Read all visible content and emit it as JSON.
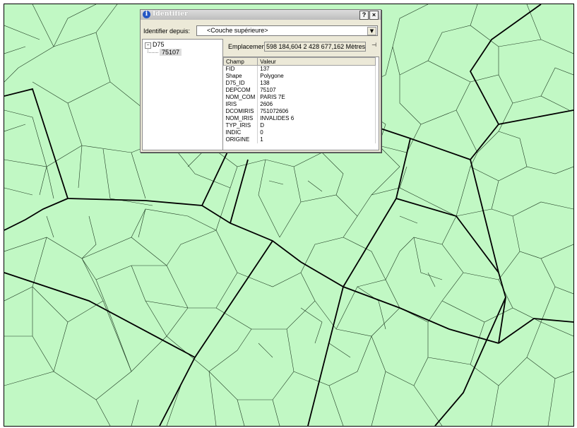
{
  "window": {
    "title": "Identifier",
    "help_glyph": "?",
    "close_glyph": "×",
    "identify_from_label": "Identifier depuis:",
    "identify_from_value": "<Couche supérieure>",
    "dropdown_glyph": "▼"
  },
  "tree": {
    "expander_glyph": "−",
    "root": "D75",
    "child": "75107"
  },
  "location": {
    "label": "Emplacement:",
    "value": "598 184,604  2 428 677,162 Mètres"
  },
  "table": {
    "headers": [
      "Champ",
      "Valeur"
    ],
    "rows": [
      [
        "FID",
        "137"
      ],
      [
        "Shape",
        "Polygone"
      ],
      [
        "D75_ID",
        "138"
      ],
      [
        "DEPCOM",
        "75107"
      ],
      [
        "NOM_COM",
        "PARIS 7E"
      ],
      [
        "IRIS",
        "2606"
      ],
      [
        "DCOMIRIS",
        "751072606"
      ],
      [
        "NOM_IRIS",
        "INVALIDES 6"
      ],
      [
        "TYP_IRIS",
        "D"
      ],
      [
        "INDIC",
        "0"
      ],
      [
        "ORIGINE",
        "1"
      ]
    ]
  },
  "map": {
    "fill_color": "#c1f8c4",
    "line_color": "#000000"
  }
}
